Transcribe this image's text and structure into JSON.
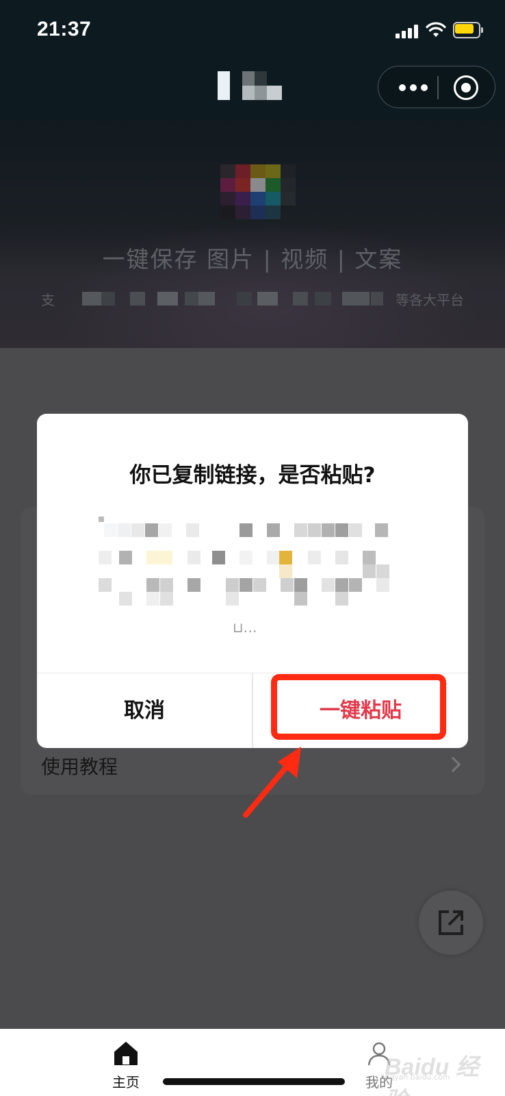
{
  "status_bar": {
    "time": "21:37",
    "battery_level": 0.8,
    "battery_color": "#ffd60a"
  },
  "nav": {
    "capsule_more_icon": "more-dots-icon",
    "capsule_close_icon": "target-circle-icon"
  },
  "hero": {
    "headline": "一键保存 图片 | 视频 | 文案",
    "sub_lead": "支",
    "sub_tail": "等各大平台"
  },
  "main": {
    "tutorial_label": "使用教程"
  },
  "dialog": {
    "title": "你已复制链接，是否粘贴?",
    "body_tail": "⊔…",
    "cancel_label": "取消",
    "paste_label": "一键粘贴",
    "paste_color": "#e03a4a"
  },
  "annotation": {
    "color": "#ff2a12"
  },
  "tabbar": {
    "home_label": "主页",
    "mine_label": "我的"
  },
  "watermark": {
    "text": "Baidu 经验",
    "sub": "jingyan.baidu.com"
  }
}
